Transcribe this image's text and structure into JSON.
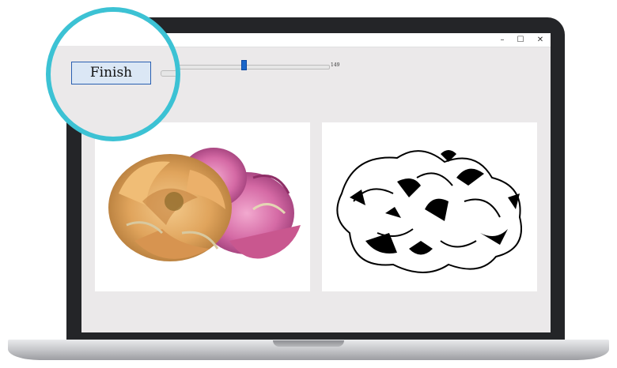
{
  "window": {
    "minimize_glyph": "–",
    "maximize_glyph": "☐",
    "close_glyph": "✕"
  },
  "toolbar": {
    "finish_label": "Finish",
    "slider": {
      "value": "149",
      "fraction": 0.58
    }
  },
  "images": {
    "left": {
      "description_icon": "peony-color-image"
    },
    "right": {
      "description_icon": "peony-threshold-image"
    }
  },
  "colors": {
    "magnifier_ring": "#3cc2d4",
    "button_fill": "#dbe7f5",
    "button_border": "#2a5fb1",
    "slider_thumb": "#1a66c9"
  }
}
